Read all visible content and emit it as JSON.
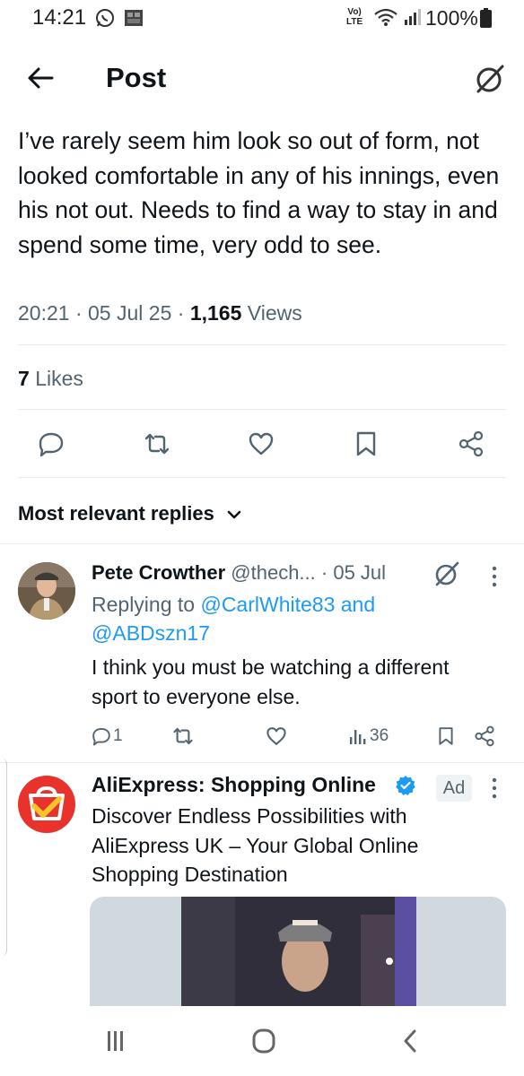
{
  "status_bar": {
    "time": "14:21",
    "network_top": "Vo)",
    "network_bottom": "LTE",
    "battery": "100%"
  },
  "header": {
    "title": "Post"
  },
  "post": {
    "text": "I’ve rarely seem him look so out of form, not looked comfortable in any of his innings, even his not out. Needs to find a way to stay in and spend some time, very odd to see.",
    "time": "20:21",
    "date": "05 Jul 25",
    "views_count": "1,165",
    "views_label": "Views",
    "sep": "·",
    "likes_count": "7",
    "likes_label": "Likes"
  },
  "replies_section": {
    "sort_label": "Most relevant replies"
  },
  "reply": {
    "name": "Pete Crowther",
    "handle": "@thech...",
    "date": "· 05 Jul",
    "replying_prefix": "Replying to",
    "replying_user1": "@CarlWhite83",
    "replying_and": "and",
    "replying_user2": "@ABDszn17",
    "text": "I think you must be watching a different sport to everyone else.",
    "reply_count": "1",
    "views": "36"
  },
  "ad": {
    "name": "AliExpress: Shopping Online",
    "badge": "Ad",
    "text": "Discover Endless Possibilities with AliExpress UK – Your Global Online Shopping Destination"
  },
  "colors": {
    "accent": "#1d9bf0",
    "text": "#0f1419",
    "muted": "#536471",
    "ad_brand": "#e8322b"
  }
}
